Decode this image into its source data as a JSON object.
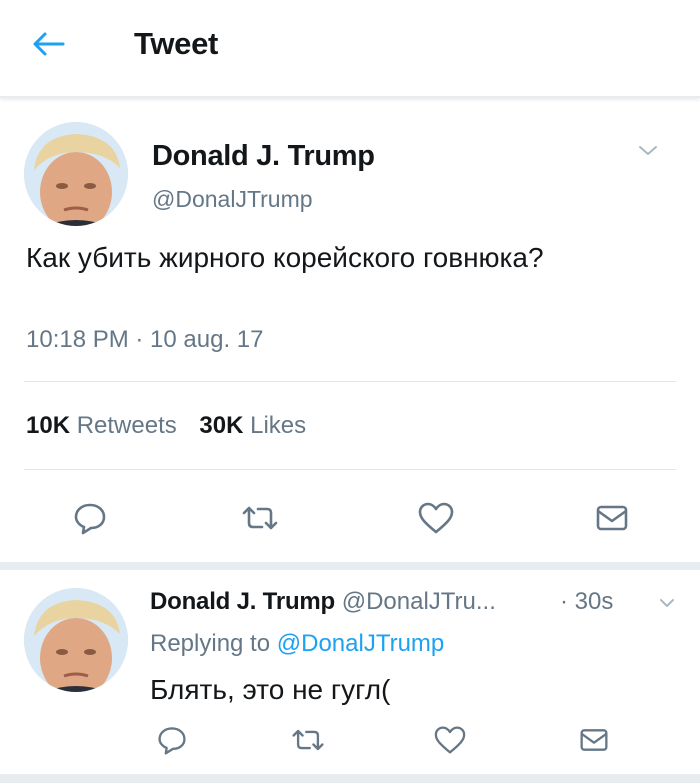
{
  "header": {
    "title": "Tweet",
    "back_icon": "arrow-left-icon",
    "accent_color": "#1da1f2"
  },
  "tweet": {
    "author_name": "Donald J. Trump",
    "handle": "@DonalJTrump",
    "text": "Как убить жирного корейского говнюка?",
    "timestamp": "10:18 PM · 10 aug. 17",
    "retweets_count": "10K",
    "retweets_label": "Retweets",
    "likes_count": "30K",
    "likes_label": "Likes",
    "actions": [
      "reply-icon",
      "retweet-icon",
      "like-icon",
      "message-icon"
    ]
  },
  "reply": {
    "author_name": "Donald J. Trump",
    "handle": "@DonalJTru...",
    "time": "· 30s",
    "replying_prefix": "Replying to",
    "replying_handle": "@DonalJTrump",
    "text": "Блять, это не гугл("
  }
}
